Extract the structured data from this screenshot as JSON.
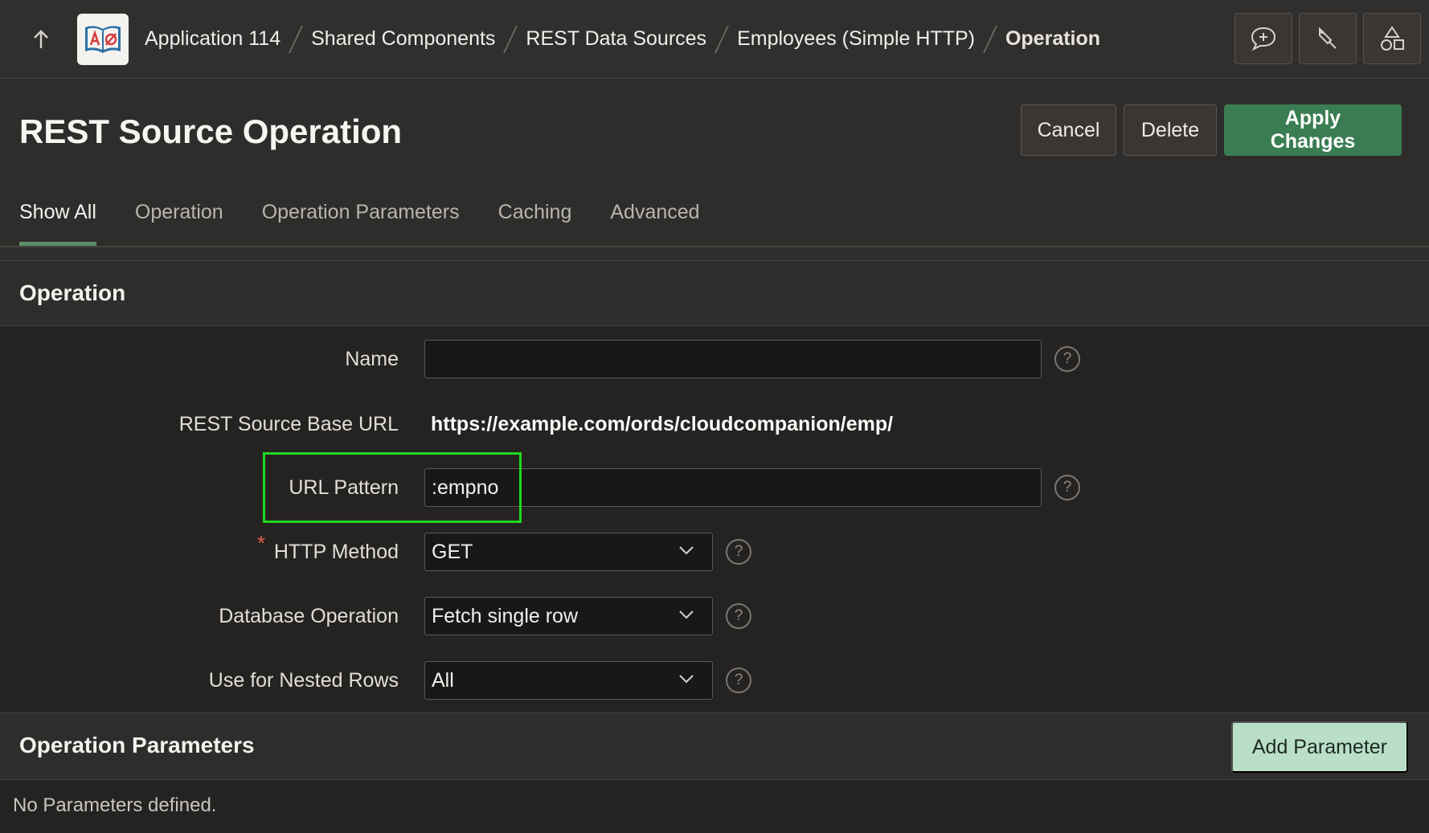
{
  "breadcrumb": {
    "items": [
      "Application 114",
      "Shared Components",
      "REST Data Sources",
      "Employees (Simple HTTP)"
    ],
    "current": "Operation"
  },
  "page": {
    "title": "REST Source Operation",
    "buttons": {
      "cancel": "Cancel",
      "delete": "Delete",
      "apply": "Apply Changes"
    }
  },
  "tabs": [
    "Show All",
    "Operation",
    "Operation Parameters",
    "Caching",
    "Advanced"
  ],
  "operation_region": {
    "title": "Operation",
    "fields": {
      "name": {
        "label": "Name",
        "value": ""
      },
      "base_url": {
        "label": "REST Source Base URL",
        "value": "https://example.com/ords/cloudcompanion/emp/"
      },
      "url_pattern": {
        "label": "URL Pattern",
        "value": ":empno"
      },
      "http_method": {
        "label": "HTTP Method",
        "value": "GET",
        "required_mark": "*"
      },
      "db_operation": {
        "label": "Database Operation",
        "value": "Fetch single row"
      },
      "nested_rows": {
        "label": "Use for Nested Rows",
        "value": "All"
      }
    },
    "help_glyph": "?"
  },
  "parameters_region": {
    "title": "Operation Parameters",
    "add_button": "Add Parameter",
    "empty_message": "No Parameters defined."
  },
  "colors": {
    "accent": "#3a7d52",
    "highlight": "#1fd81f",
    "required": "#e05d4a"
  },
  "icons": [
    "arrow-up-icon",
    "app-logo-icon",
    "add-comment-icon",
    "pin-icon",
    "shapes-icon",
    "chevron-down-icon",
    "help-icon"
  ]
}
